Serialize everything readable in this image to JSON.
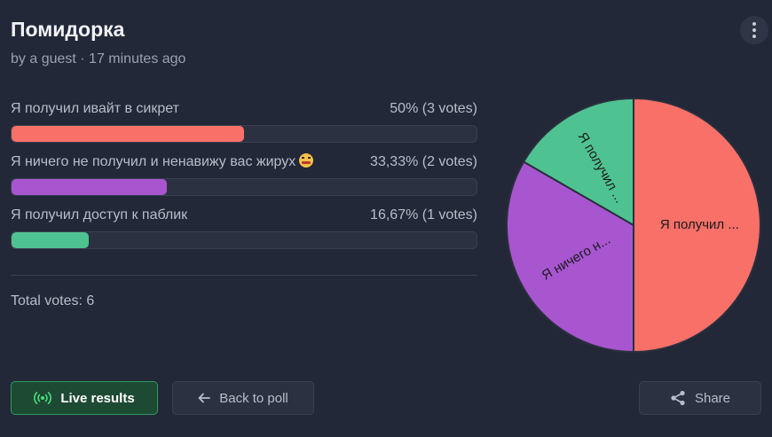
{
  "poll": {
    "title": "Помидорка",
    "byline": "by a guest · 17 minutes ago",
    "total_votes": "Total votes: 6"
  },
  "options": [
    {
      "label": "Я получил ивайт в сикрет",
      "result": "50% (3 votes)",
      "percent": 50,
      "color": "#f87068"
    },
    {
      "label": "Я ничего не получил и ненавижу вас жирух",
      "result": "33,33% (2 votes)",
      "percent": 33.33,
      "color": "#a855d0",
      "icon": "angry-face-icon"
    },
    {
      "label": "Я получил доступ к паблик",
      "result": "16,67% (1 votes)",
      "percent": 16.67,
      "color": "#4fc291"
    }
  ],
  "chart_data": {
    "type": "pie",
    "categories": [
      "Я получил ...",
      "Я ничего н...",
      "Я получил ..."
    ],
    "values": [
      3,
      2,
      1
    ],
    "colors": [
      "#f87068",
      "#a855d0",
      "#4fc291"
    ]
  },
  "buttons": {
    "live": "Live results",
    "back": "Back to poll",
    "share": "Share"
  },
  "icons": {
    "menu": "more-vertical-icon",
    "live": "broadcast-icon",
    "back": "arrow-left-icon",
    "share": "share-icon"
  }
}
